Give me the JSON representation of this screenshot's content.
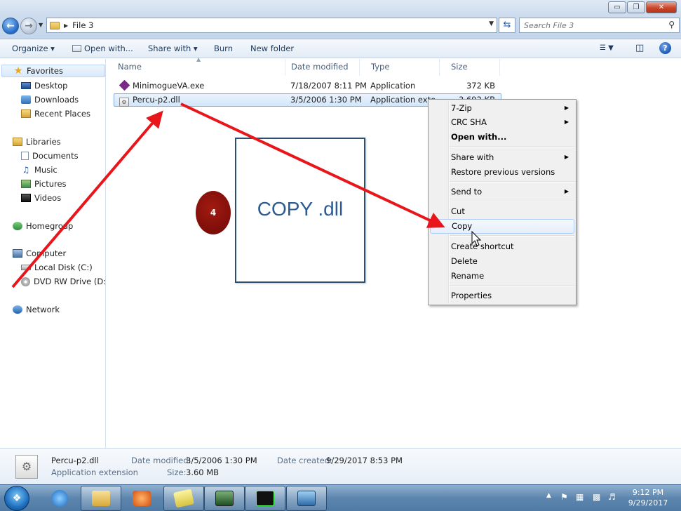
{
  "window": {
    "controls": [
      "▭",
      "❐",
      "✕"
    ]
  },
  "address": {
    "path": "File 3"
  },
  "search": {
    "placeholder": "Search File 3"
  },
  "toolbar": {
    "organize": "Organize ▾",
    "open_with": "Open with...",
    "share_with": "Share with ▾",
    "burn": "Burn",
    "new_folder": "New folder"
  },
  "nav": {
    "favorites": "Favorites",
    "desktop": "Desktop",
    "downloads": "Downloads",
    "recent_places": "Recent Places",
    "libraries": "Libraries",
    "documents": "Documents",
    "music": "Music",
    "pictures": "Pictures",
    "videos": "Videos",
    "homegroup": "Homegroup",
    "computer": "Computer",
    "local_disk": "Local Disk (C:)",
    "dvd_drive": "DVD RW Drive (D:) M",
    "network": "Network"
  },
  "columns": {
    "name": "Name",
    "date_modified": "Date modified",
    "type": "Type",
    "size": "Size"
  },
  "files": [
    {
      "name": "MinimogueVA.exe",
      "date": "7/18/2007 8:11 PM",
      "type": "Application",
      "size": "372 KB"
    },
    {
      "name": "Percu-p2.dll",
      "date": "3/5/2006 1:30 PM",
      "type": "Application exte",
      "size": "3,692 KB"
    }
  ],
  "annotation": {
    "step_number": "4",
    "label": "COPY .dll"
  },
  "context_menu": {
    "zip": "7-Zip",
    "crc": "CRC SHA",
    "open_with": "Open with...",
    "share_with": "Share with",
    "restore": "Restore previous versions",
    "send_to": "Send to",
    "cut": "Cut",
    "copy": "Copy",
    "create_shortcut": "Create shortcut",
    "delete": "Delete",
    "rename": "Rename",
    "properties": "Properties"
  },
  "details": {
    "file_name": "Percu-p2.dll",
    "file_type": "Application extension",
    "date_modified_label": "Date modified:",
    "date_modified_value": "3/5/2006 1:30 PM",
    "size_label": "Size:",
    "size_value": "3.60 MB",
    "date_created_label": "Date created:",
    "date_created_value": "9/29/2017 8:53 PM"
  },
  "taskbar": {
    "time": "9:12 PM",
    "date": "9/29/2017"
  },
  "colors": {
    "arrow_red": "#e8161b",
    "step_circle": "#8a1109",
    "annotation_text": "#2d5a91",
    "selection_border": "#84acdd"
  }
}
